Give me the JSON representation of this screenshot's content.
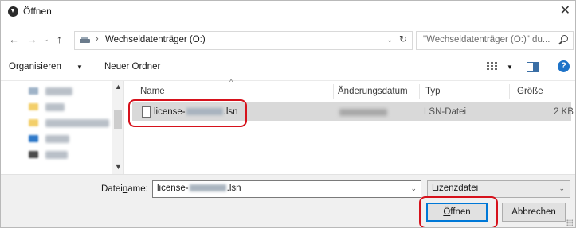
{
  "window": {
    "title": "Öffnen",
    "close_icon": "✕"
  },
  "address": {
    "drive_label": "Wechseldatenträger (O:)",
    "search_placeholder": "\"Wechseldatenträger (O:)\" du..."
  },
  "toolbar": {
    "organize_label": "Organisieren",
    "new_folder_label": "Neuer Ordner",
    "help_label": "?"
  },
  "columns": {
    "name": "Name",
    "date": "Änderungsdatum",
    "type": "Typ",
    "size": "Größe"
  },
  "files": [
    {
      "name_prefix": "license-",
      "name_suffix": ".lsn",
      "type": "LSN-Datei",
      "size": "2 KB",
      "selected": true
    }
  ],
  "bottom": {
    "filename_label_pre": "Datei",
    "filename_label_accel": "n",
    "filename_label_post": "ame:",
    "filename_prefix": "license-",
    "filename_suffix": ".lsn",
    "filetype_value": "Lizenzdatei",
    "open_label_accel": "Ö",
    "open_label_rest": "ffnen",
    "cancel_label": "Abbrechen"
  },
  "highlight_color": "#d6121c",
  "icons": {
    "back": "back-arrow-icon",
    "forward": "forward-arrow-icon",
    "up": "up-arrow-icon",
    "refresh": "refresh-icon",
    "search": "search-icon",
    "help": "help-icon",
    "view": "view-options-icon",
    "preview": "preview-pane-icon",
    "file": "document-icon",
    "drive": "drive-icon"
  }
}
